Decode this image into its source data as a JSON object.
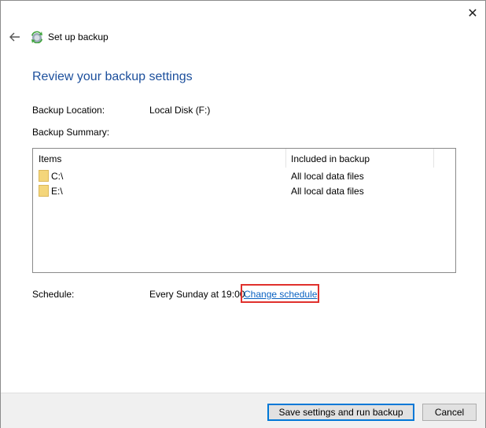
{
  "window": {
    "title": "Set up backup",
    "close_glyph": "✕"
  },
  "main": {
    "heading": "Review your backup settings",
    "backup_location_label": "Backup Location:",
    "backup_location_value": "Local Disk (F:)",
    "backup_summary_label": "Backup Summary:",
    "table": {
      "columns": [
        "Items",
        "Included in backup"
      ],
      "rows": [
        {
          "name": "C:\\",
          "included": "All local data files"
        },
        {
          "name": "E:\\",
          "included": "All local data files"
        }
      ]
    },
    "schedule_label": "Schedule:",
    "schedule_value": "Every Sunday at 19:00",
    "change_schedule_link": "Change schedule"
  },
  "footer": {
    "save_run_label": "Save settings and run backup",
    "cancel_label": "Cancel"
  },
  "colors": {
    "heading": "#1c4f9c",
    "link": "#0a62c2",
    "highlight": "#e0302c",
    "folder": "#f4d67b"
  }
}
